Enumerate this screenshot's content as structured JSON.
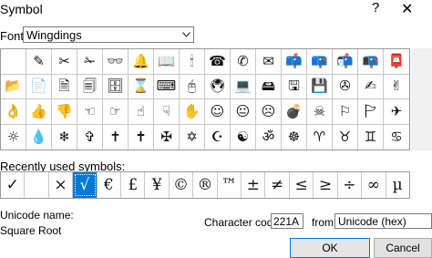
{
  "dialog": {
    "title": "Symbol",
    "help_label": "?",
    "close_label": "✕"
  },
  "font": {
    "label": "Font:",
    "value": "Wingdings"
  },
  "grid": {
    "symbols": [
      "",
      "✎",
      "✂",
      "✁",
      "👓",
      "🔔",
      "📖",
      "🕯",
      "☎",
      "✆",
      "✉",
      "📫",
      "📪",
      "📬",
      "📭",
      "📮",
      "📂",
      "📄",
      "🗎",
      "🗐",
      "🗄",
      "⌛",
      "⌨",
      "🖰",
      "🖲",
      "💻",
      "🖴",
      "🖫",
      "💾",
      "✇",
      "✍",
      "✌",
      "👌",
      "👍",
      "👎",
      "☜",
      "☞",
      "☝",
      "☟",
      "✋",
      "☺",
      "😐",
      "☹",
      "💣",
      "☠",
      "⚐",
      "🏱",
      "✈",
      "☼",
      "💧",
      "❄",
      "✞",
      "✝",
      "🕇",
      "✠",
      "✡",
      "☪",
      "☯",
      "ॐ",
      "☸",
      "♈",
      "♉",
      "♊",
      "♋"
    ]
  },
  "recent": {
    "label": "Recently used symbols:",
    "symbols": [
      "✓",
      "",
      "×",
      "√",
      "€",
      "£",
      "¥",
      "©",
      "®",
      "™",
      "±",
      "≠",
      "≤",
      "≥",
      "÷",
      "∞",
      "µ"
    ]
  },
  "unicode": {
    "label": "Unicode name:",
    "name": "Square Root"
  },
  "char_code": {
    "label": "Character code:",
    "value": "221A"
  },
  "from": {
    "label": "from:",
    "value": "Unicode (hex)"
  },
  "buttons": {
    "ok": "OK",
    "cancel": "Cancel"
  }
}
